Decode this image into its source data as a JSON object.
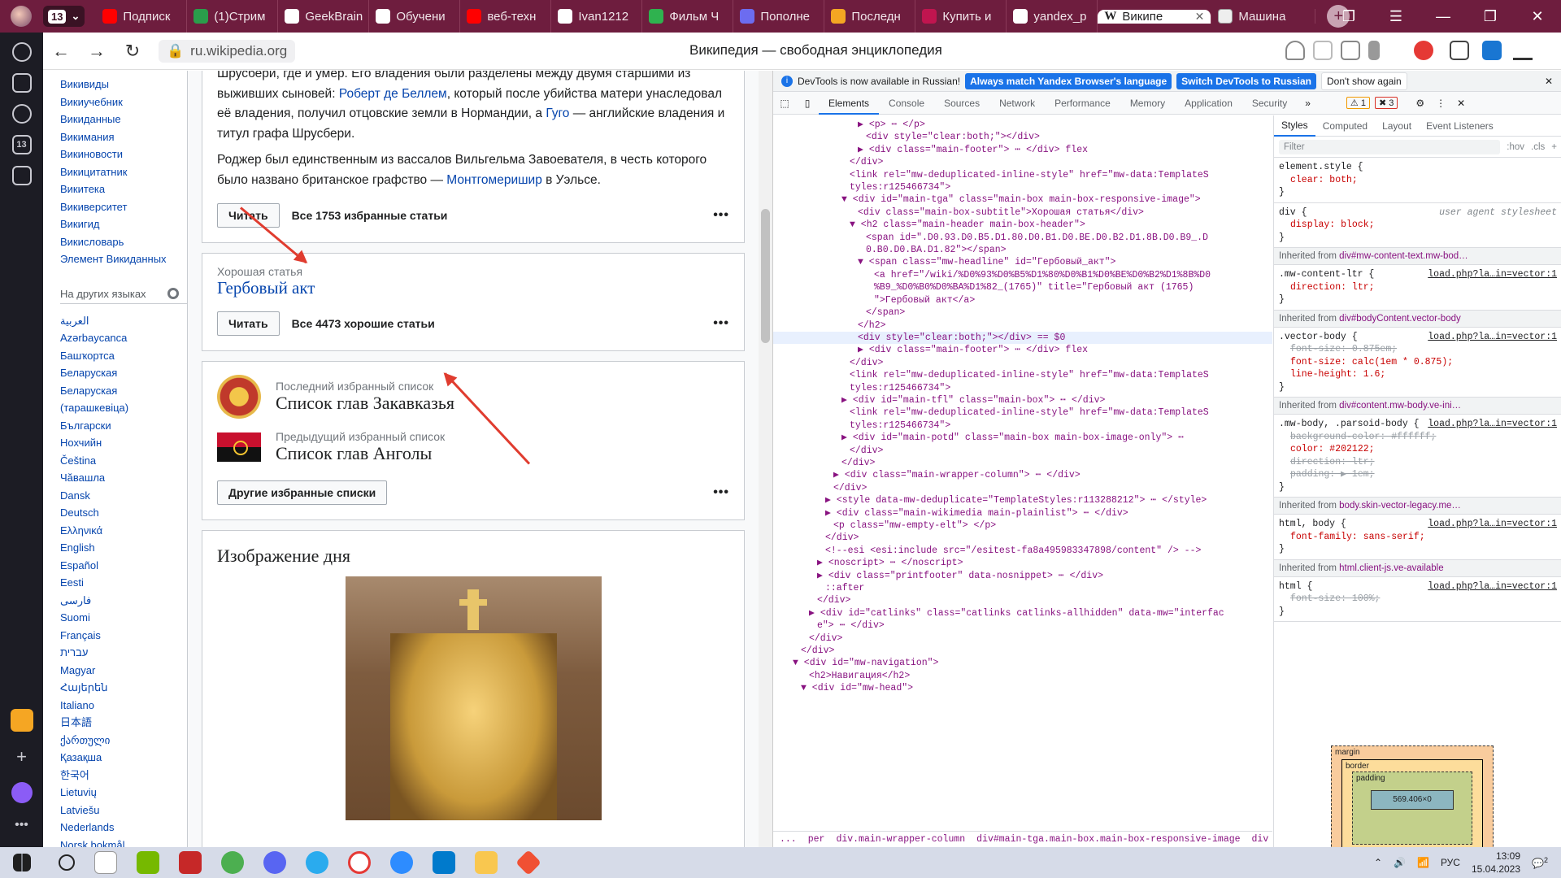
{
  "browser": {
    "tab_count": "13",
    "tabs": [
      {
        "label": "Подписк",
        "color": "#ff0000"
      },
      {
        "label": "(1)Стрим",
        "color": "#2a9d4b"
      },
      {
        "label": "GeekBrain",
        "color": "#ffffff"
      },
      {
        "label": "Обучени",
        "color": "#ffffff"
      },
      {
        "label": "веб-техн",
        "color": "#ff0000"
      },
      {
        "label": "Ivan1212",
        "color": "#ffffff"
      },
      {
        "label": "Фильм Ч",
        "color": "#2fb24f"
      },
      {
        "label": "Пополне",
        "color": "#6c6cf0"
      },
      {
        "label": "Последн",
        "color": "#f4a623"
      },
      {
        "label": "Купить и",
        "color": "#c0154f"
      },
      {
        "label": "yandex_p",
        "color": "#ffffff"
      }
    ],
    "active_tab": {
      "label": "Википе",
      "icon": "W"
    },
    "next_tab": {
      "label": "Машина"
    },
    "url": "ru.wikipedia.org",
    "page_title": "Википедия — свободная энциклопедия"
  },
  "sidebar": {
    "projects": [
      "Викивиды",
      "Викиучебник",
      "Викиданные",
      "Викимания",
      "Викиновости",
      "Викицитатник",
      "Викитека",
      "Викиверситет",
      "Викигид",
      "Викисловарь",
      "Элемент Викиданных"
    ],
    "lang_header": "На других языках",
    "languages": [
      "العربية",
      "Azərbaycanca",
      "Башҡортса",
      "Беларуская",
      "Беларуская (тарашкевіца)",
      "Български",
      "Нохчийн",
      "Čeština",
      "Чӑвашла",
      "Dansk",
      "Deutsch",
      "Ελληνικά",
      "English",
      "Español",
      "Eesti",
      "فارسی",
      "Suomi",
      "Français",
      "עברית",
      "Magyar",
      "Հայերեն",
      "Italiano",
      "日本語",
      "ქართული",
      "Қазақша",
      "한국어",
      "Lietuvių",
      "Latviešu",
      "Nederlands",
      "Norsk bokmål"
    ]
  },
  "featured": {
    "p1_pre": "Шрусбери, где и умер. Его владения были разделены между двумя старшими из выживших сыновей: ",
    "p1_link1": "Роберт де Беллем",
    "p1_mid": ", который после убийства матери унаследовал её владения, получил отцовские земли в Нормандии, а ",
    "p1_link2": "Гуго",
    "p1_post": " — английские владения и титул графа Шрусбери.",
    "p2_pre": "Роджер был единственным из вассалов Вильгельма Завоевателя, в честь которого было названо британское графство — ",
    "p2_link": "Монтгомеришир",
    "p2_post": " в Уэльсе.",
    "read_btn": "Читать",
    "all_link": "Все 1753 избранные статьи",
    "more": "•••"
  },
  "good": {
    "subtitle": "Хорошая статья",
    "title": "Гербовый акт",
    "read_btn": "Читать",
    "all_link": "Все 4473 хорошие статьи",
    "more": "•••"
  },
  "lists": {
    "last_sub": "Последний избранный список",
    "last_title": "Список глав Закавказья",
    "prev_sub": "Предыдущий избранный список",
    "prev_title": "Список глав Анголы",
    "other_btn": "Другие избранные списки",
    "more": "•••"
  },
  "image_of_day": {
    "title": "Изображение дня"
  },
  "devtools": {
    "info": "DevTools is now available in Russian!",
    "btn_match": "Always match Yandex Browser's language",
    "btn_switch": "Switch DevTools to Russian",
    "btn_dont": "Don't show again",
    "tabs": [
      "Elements",
      "Console",
      "Sources",
      "Network",
      "Performance",
      "Memory",
      "Application",
      "Security"
    ],
    "warn_count": "1",
    "err_count": "3",
    "style_tabs": [
      "Styles",
      "Computed",
      "Layout",
      "Event Listeners"
    ],
    "filter_placeholder": "Filter",
    "hov": ":hov",
    "cls": ".cls",
    "breadcrumbs": [
      "...",
      "per",
      "div.main-wrapper-column",
      "div#main-tga.main-box.main-box-responsive-image",
      "div",
      "..."
    ],
    "box_model": {
      "margin": "margin",
      "border": "border",
      "padding": "padding",
      "content": "569.406×0",
      "dash": "–"
    }
  },
  "dom_lines": [
    {
      "i": 10,
      "t": "▶ <p> ⋯ </p>"
    },
    {
      "i": 11,
      "t": "<div style=\"clear:both;\"></div>"
    },
    {
      "i": 10,
      "t": "▶ <div class=\"main-footer\"> ⋯ </div> flex"
    },
    {
      "i": 9,
      "t": "</div>"
    },
    {
      "i": 9,
      "t": "<link rel=\"mw-deduplicated-inline-style\" href=\"mw-data:TemplateS"
    },
    {
      "i": 9,
      "t": "tyles:r125466734\">"
    },
    {
      "i": 8,
      "t": "▼ <div id=\"main-tga\" class=\"main-box main-box-responsive-image\">"
    },
    {
      "i": 10,
      "t": "<div class=\"main-box-subtitle\">Хорошая статья</div>"
    },
    {
      "i": 9,
      "t": "▼ <h2 class=\"main-header main-box-header\">"
    },
    {
      "i": 11,
      "t": "<span id=\".D0.93.D0.B5.D1.80.D0.B1.D0.BE.D0.B2.D1.8B.D0.B9_.D"
    },
    {
      "i": 11,
      "t": "0.B0.D0.BA.D1.82\"></span>"
    },
    {
      "i": 10,
      "t": "▼ <span class=\"mw-headline\" id=\"Гербовый_акт\">"
    },
    {
      "i": 12,
      "t": "<a href=\"/wiki/%D0%93%D0%B5%D1%80%D0%B1%D0%BE%D0%B2%D1%8B%D0"
    },
    {
      "i": 12,
      "t": "%B9_%D0%B0%D0%BA%D1%82_(1765)\" title=\"Гербовый акт (1765)"
    },
    {
      "i": 12,
      "t": "\">Гербовый акт</a>"
    },
    {
      "i": 11,
      "t": "</span>"
    },
    {
      "i": 10,
      "t": "</h2>"
    },
    {
      "i": 10,
      "t": "<div style=\"clear:both;\"></div> == $0",
      "sel": true
    },
    {
      "i": 10,
      "t": "▶ <div class=\"main-footer\"> ⋯ </div> flex"
    },
    {
      "i": 9,
      "t": "</div>"
    },
    {
      "i": 9,
      "t": "<link rel=\"mw-deduplicated-inline-style\" href=\"mw-data:TemplateS"
    },
    {
      "i": 9,
      "t": "tyles:r125466734\">"
    },
    {
      "i": 8,
      "t": "▶ <div id=\"main-tfl\" class=\"main-box\"> ⋯ </div>"
    },
    {
      "i": 9,
      "t": "<link rel=\"mw-deduplicated-inline-style\" href=\"mw-data:TemplateS"
    },
    {
      "i": 9,
      "t": "tyles:r125466734\">"
    },
    {
      "i": 8,
      "t": "▶ <div id=\"main-potd\" class=\"main-box main-box-image-only\"> ⋯"
    },
    {
      "i": 9,
      "t": "</div>"
    },
    {
      "i": 8,
      "t": "</div>"
    },
    {
      "i": 7,
      "t": "▶ <div class=\"main-wrapper-column\"> ⋯ </div>"
    },
    {
      "i": 7,
      "t": "</div>"
    },
    {
      "i": 6,
      "t": "▶ <style data-mw-deduplicate=\"TemplateStyles:r113288212\"> ⋯ </style>"
    },
    {
      "i": 6,
      "t": "▶ <div class=\"main-wikimedia main-plainlist\"> ⋯ </div>"
    },
    {
      "i": 7,
      "t": "<p class=\"mw-empty-elt\"> </p>"
    },
    {
      "i": 6,
      "t": "</div>"
    },
    {
      "i": 6,
      "t": "<!--esi <esi:include src=\"/esitest-fa8a495983347898/content\" /> -->"
    },
    {
      "i": 5,
      "t": "▶ <noscript> ⋯ </noscript>"
    },
    {
      "i": 5,
      "t": "▶ <div class=\"printfooter\" data-nosnippet> ⋯ </div>"
    },
    {
      "i": 6,
      "t": "::after"
    },
    {
      "i": 5,
      "t": "</div>"
    },
    {
      "i": 4,
      "t": "▶ <div id=\"catlinks\" class=\"catlinks catlinks-allhidden\" data-mw=\"interfac"
    },
    {
      "i": 5,
      "t": "e\"> ⋯ </div>"
    },
    {
      "i": 4,
      "t": "</div>"
    },
    {
      "i": 3,
      "t": "</div>"
    },
    {
      "i": 2,
      "t": "▼ <div id=\"mw-navigation\">"
    },
    {
      "i": 4,
      "t": "<h2>Навигация</h2>"
    },
    {
      "i": 3,
      "t": "▼ <div id=\"mw-head\">"
    }
  ],
  "css_rules": {
    "element_style": "element.style {",
    "element_decl": "clear: both;",
    "div_rule": "div {",
    "div_src": "user agent stylesheet",
    "div_decl": "display: block;",
    "inh1": "Inherited from",
    "inh1_sel": "div#mw-content-text.mw-bod…",
    "mcl_sel": ".mw-content-ltr {",
    "mcl_src": "load.php?la…in=vector:1",
    "mcl_decl": "direction: ltr;",
    "inh2_sel": "div#bodyContent.vector-body",
    "vb_sel": ".vector-body {",
    "vb_src": "load.php?la…in=vector:1",
    "vb_decl1": "font-size: 0.875em;",
    "vb_decl2": "font-size: calc(1em * 0.875);",
    "vb_decl3": "line-height: 1.6;",
    "inh3_sel": "div#content.mw-body.ve-ini…",
    "mb_sel": ".mw-body, .parsoid-body {",
    "mb_src": "load.php?la…in=vector:1",
    "mb_decl1": "background-color: #ffffff;",
    "mb_decl2": "color: #202122;",
    "mb_decl3": "direction: ltr;",
    "mb_decl4": "padding: ▶ 1em;",
    "inh4_sel": "body.skin-vector-legacy.me…",
    "hb_sel": "html, body {",
    "hb_src": "load.php?la…in=vector:1",
    "hb_decl": "font-family: sans-serif;",
    "inh5_sel": "html.client-js.ve-available",
    "h_sel": "html {",
    "h_src": "load.php?la…in=vector:1",
    "h_decl": "font-size: 100%;"
  },
  "taskbar": {
    "lang": "РУС",
    "time": "13:09",
    "date": "15.04.2023",
    "notif": "2"
  }
}
